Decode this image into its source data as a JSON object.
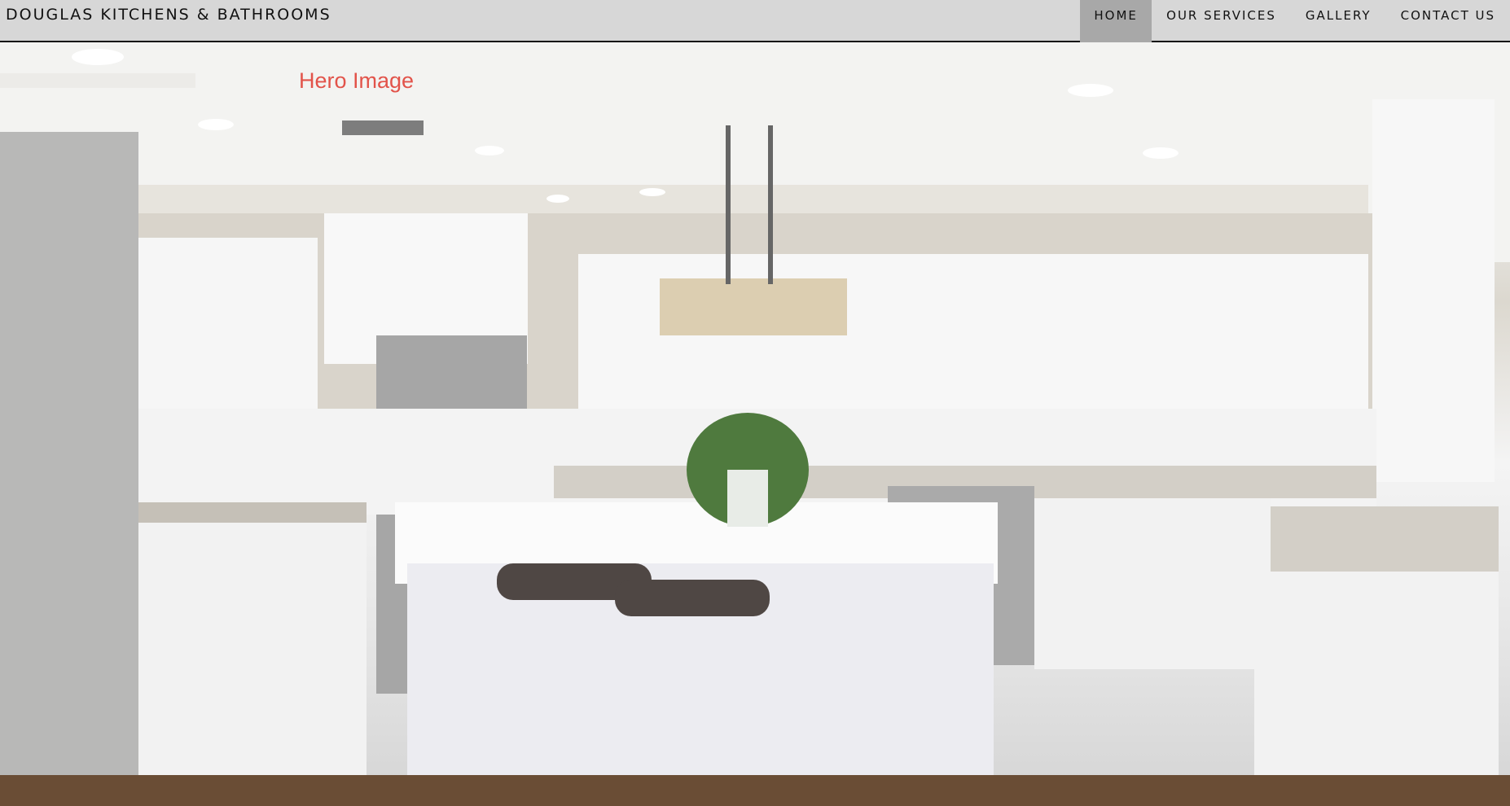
{
  "brand": "DOUGLAS KITCHENS & BATHROOMS",
  "nav": {
    "items": [
      {
        "label": "HOME",
        "active": true
      },
      {
        "label": "OUR SERVICES",
        "active": false
      },
      {
        "label": "GALLERY",
        "active": false
      },
      {
        "label": "CONTACT US",
        "active": false
      }
    ]
  },
  "hero": {
    "label": "Hero Image"
  },
  "colors": {
    "topbar": "#d7d7d7",
    "active_nav": "#a8a8a8",
    "hero_label": "#e2534a"
  }
}
